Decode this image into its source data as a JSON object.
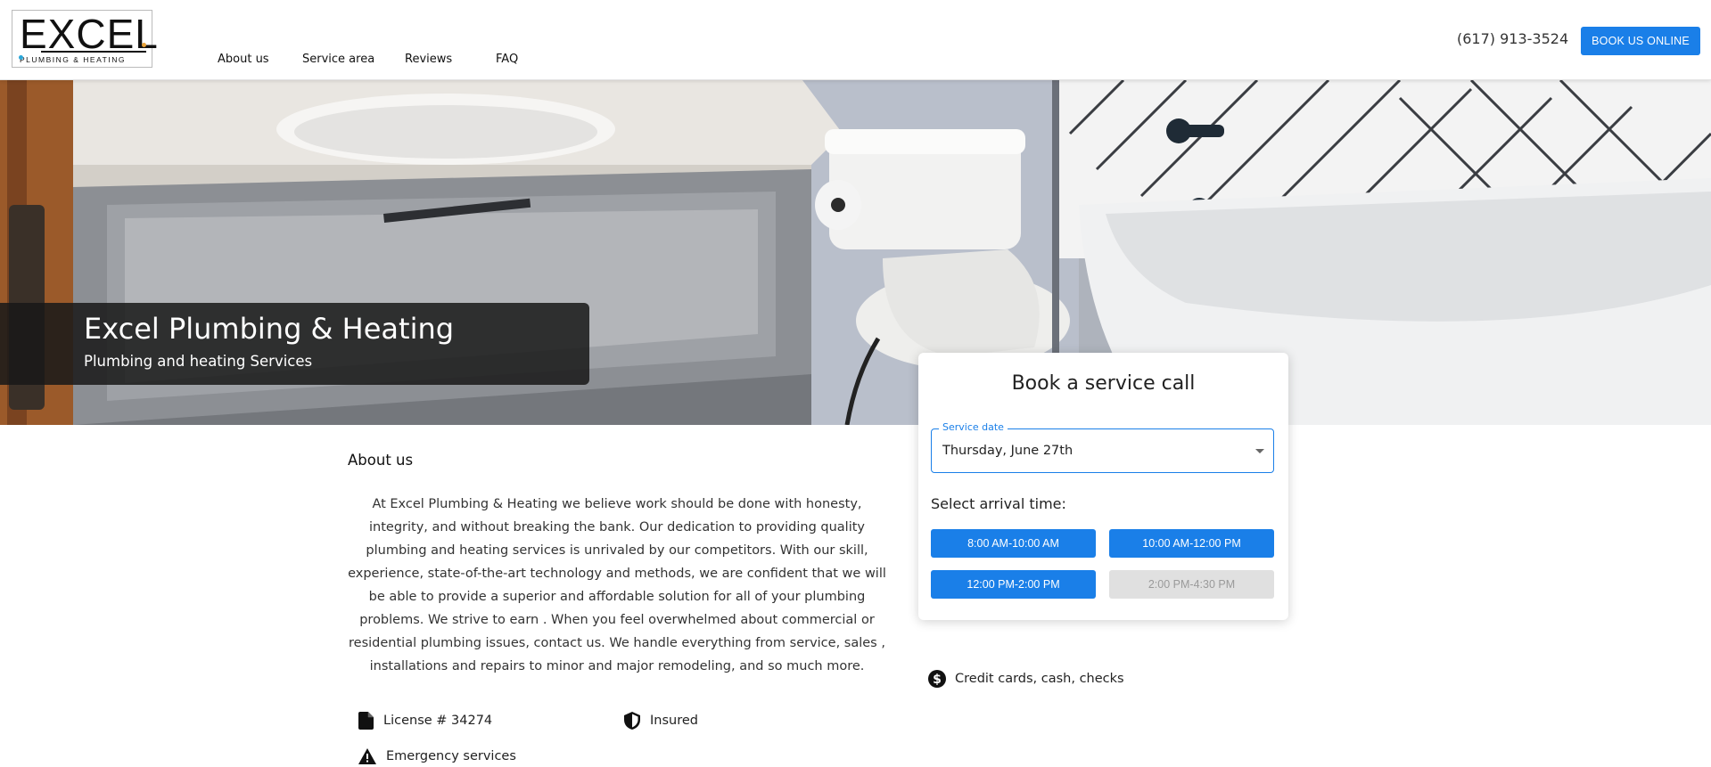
{
  "header": {
    "logo": {
      "word": "EXCEL",
      "sub": "PLUMBING & HEATING"
    },
    "nav": [
      "About us",
      "Service area",
      "Reviews",
      "FAQ"
    ],
    "phone": "(617) 913-3524",
    "book_button": "BOOK US ONLINE",
    "accent_color": "#1a7fe8"
  },
  "hero": {
    "title": "Excel Plumbing & Heating",
    "subtitle": "Plumbing and heating Services"
  },
  "booking": {
    "title": "Book a service call",
    "date_label": "Service date",
    "date_value": "Thursday, June 27th",
    "arrival_label": "Select arrival time:",
    "slots": [
      {
        "label": "8:00 AM-10:00 AM",
        "available": true
      },
      {
        "label": "10:00 AM-12:00 PM",
        "available": true
      },
      {
        "label": "12:00 PM-2:00 PM",
        "available": true
      },
      {
        "label": "2:00 PM-4:30 PM",
        "available": false
      }
    ]
  },
  "about": {
    "heading": "About us",
    "text": "At Excel Plumbing & Heating we believe work should be done with honesty, integrity, and without breaking the bank. Our dedication to providing quality plumbing and heating services is unrivaled by our competitors. With our skill, experience, state-of-the-art technology and methods, we are confident that we will be able to provide a superior and affordable solution for all of your plumbing problems. We strive to earn . When you feel overwhelmed about commercial or residential plumbing issues, contact us. We handle everything from service, sales , installations and repairs to minor and major remodeling, and so much more."
  },
  "features": {
    "license": "License # 34274",
    "insured": "Insured",
    "emergency": "Emergency services",
    "payment": "Credit cards, cash, checks"
  },
  "icons": {
    "license": "document-icon",
    "insured": "shield-icon",
    "emergency": "warning-icon",
    "payment": "dollar-icon"
  }
}
